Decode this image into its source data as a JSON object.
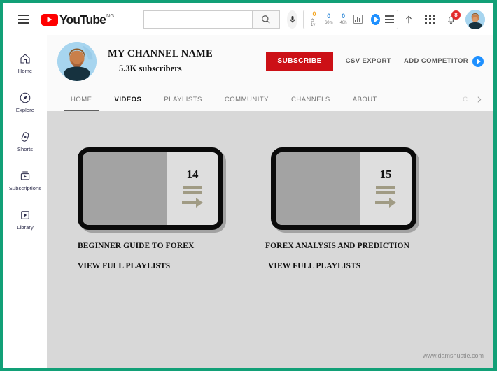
{
  "browser": {
    "border_color": "#12a077"
  },
  "topbar": {
    "menu_icon": "hamburger-icon",
    "logo_text": "YouTube",
    "country_code": "NG",
    "search": {
      "value": "",
      "placeholder": "",
      "search_icon": "search-icon",
      "mic_icon": "microphone-icon"
    },
    "vidiq": {
      "stats": [
        {
          "value": "0",
          "label": "1y",
          "color": "#f5a623"
        },
        {
          "value": "0",
          "label": "60m",
          "color": "#3a8fd9"
        },
        {
          "value": "0",
          "label": "48h",
          "color": "#3a8fd9"
        }
      ],
      "chart_icon": "bar-chart-icon",
      "logo_icon": "vidiq-logo-icon",
      "menu_icon": "vidiq-menu-icon"
    },
    "icons": {
      "upload": "upload-icon",
      "apps": "apps-grid-icon",
      "notifications": "bell-icon",
      "notification_count": "8",
      "avatar": "user-avatar"
    }
  },
  "sidebar": {
    "items": [
      {
        "label": "Home",
        "icon": "home-icon"
      },
      {
        "label": "Explore",
        "icon": "compass-icon"
      },
      {
        "label": "Shorts",
        "icon": "shorts-icon"
      },
      {
        "label": "Subscriptions",
        "icon": "subscriptions-icon"
      },
      {
        "label": "Library",
        "icon": "library-icon"
      }
    ]
  },
  "channel": {
    "name": "MY CHANNEL NAME",
    "subscribers": "5.3K subscribers",
    "avatar": "channel-avatar",
    "subscribe_label": "SUBSCRIBE",
    "subscribe_color": "#cc1016",
    "csv_export_label": "CSV EXPORT",
    "add_competitor_label": "ADD COMPETITOR",
    "add_competitor_icon": "vidiq-logo-icon"
  },
  "tabs": {
    "items": [
      {
        "label": "HOME",
        "state": "underlined"
      },
      {
        "label": "VIDEOS",
        "state": "active"
      },
      {
        "label": "PLAYLISTS",
        "state": "normal"
      },
      {
        "label": "COMMUNITY",
        "state": "normal"
      },
      {
        "label": "CHANNELS",
        "state": "normal"
      },
      {
        "label": "ABOUT",
        "state": "normal"
      }
    ],
    "overflow_partial": "C",
    "overflow_icon": "chevron-right-icon"
  },
  "playlists": [
    {
      "count": "14",
      "title": "BEGINNER GUIDE TO FOREX",
      "view_all": "VIEW FULL PLAYLISTS",
      "thumb_icon": "playlist-arrow-icon"
    },
    {
      "count": "15",
      "title": "FOREX ANALYSIS AND PREDICTION",
      "view_all": "VIEW FULL PLAYLISTS",
      "thumb_icon": "playlist-arrow-icon"
    }
  ],
  "footer": {
    "watermark": "www.damshustle.com"
  }
}
